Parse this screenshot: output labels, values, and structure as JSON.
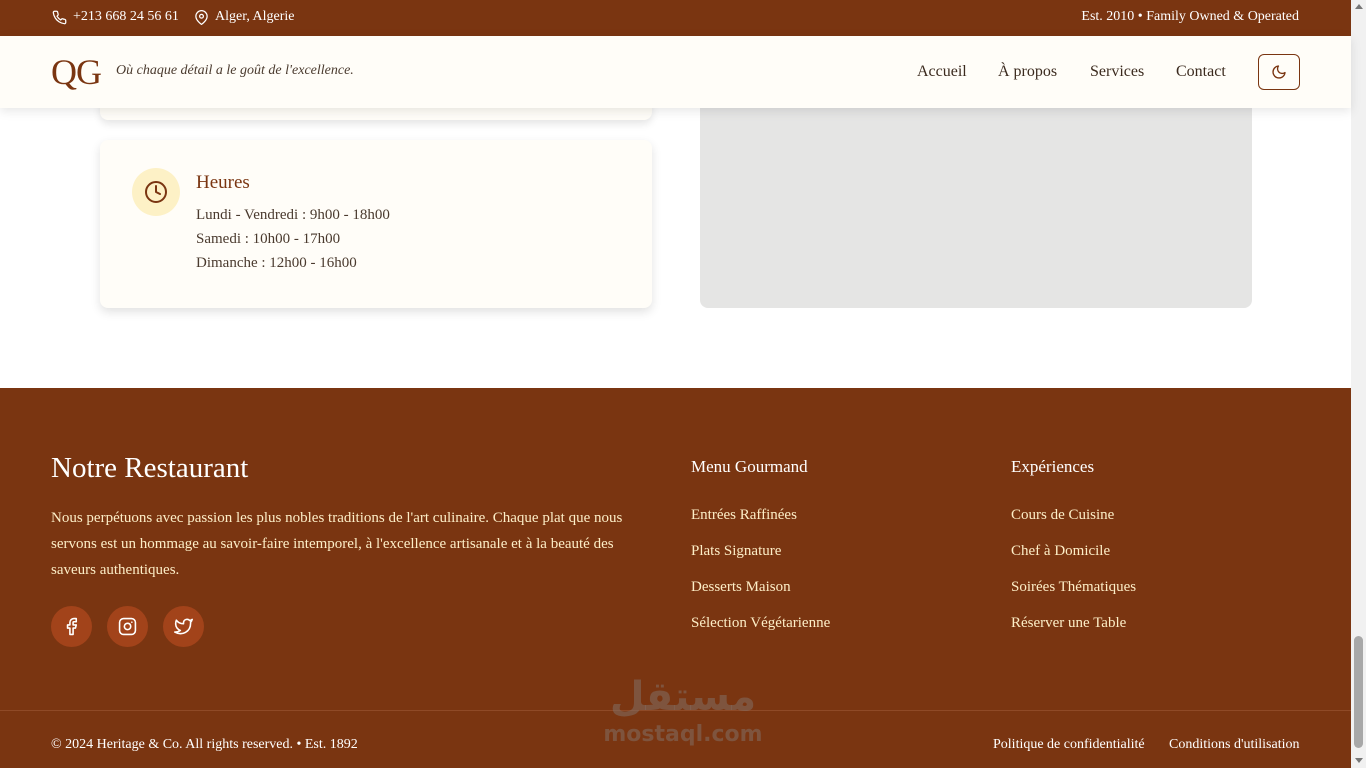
{
  "topbar": {
    "phone": "+213 668 24 56 61",
    "location": "Alger, Algerie",
    "tagline_right": "Est. 2010 • Family Owned & Operated"
  },
  "header": {
    "logo": "QG",
    "tagline": "Où chaque détail a le goût de l'excellence.",
    "nav": [
      "Accueil",
      "À propos",
      "Services",
      "Contact"
    ],
    "theme_icon": "moon-icon"
  },
  "hours": {
    "title": "Heures",
    "icon": "clock-icon",
    "lines": [
      "Lundi - Vendredi : 9h00 - 18h00",
      "Samedi : 10h00 - 17h00",
      "Dimanche : 12h00 - 16h00"
    ]
  },
  "footer": {
    "title": "Notre Restaurant",
    "description": "Nous perpétuons avec passion les plus nobles traditions de l'art culinaire. Chaque plat que nous servons est un hommage au savoir-faire intemporel, à l'excellence artisanale et à la beauté des saveurs authentiques.",
    "social": [
      "facebook-icon",
      "instagram-icon",
      "twitter-icon"
    ],
    "menu": {
      "title": "Menu Gourmand",
      "links": [
        "Entrées Raffinées",
        "Plats Signature",
        "Desserts Maison",
        "Sélection Végétarienne"
      ]
    },
    "experiences": {
      "title": "Expériences",
      "links": [
        "Cours de Cuisine",
        "Chef à Domicile",
        "Soirées Thématiques",
        "Réserver une Table"
      ]
    },
    "copyright": "© 2024 Heritage & Co. All rights reserved. • Est. 1892",
    "legal": [
      "Politique de confidentialité",
      "Conditions d'utilisation"
    ]
  },
  "watermark": {
    "arabic": "مستقل",
    "latin": "mostaql.com"
  },
  "colors": {
    "brand": "#7a3511",
    "cream": "#fffdf8",
    "footer_text": "#fdeec7",
    "icon_bg": "#fdf1c6",
    "map_bg": "#e5e5e4"
  }
}
